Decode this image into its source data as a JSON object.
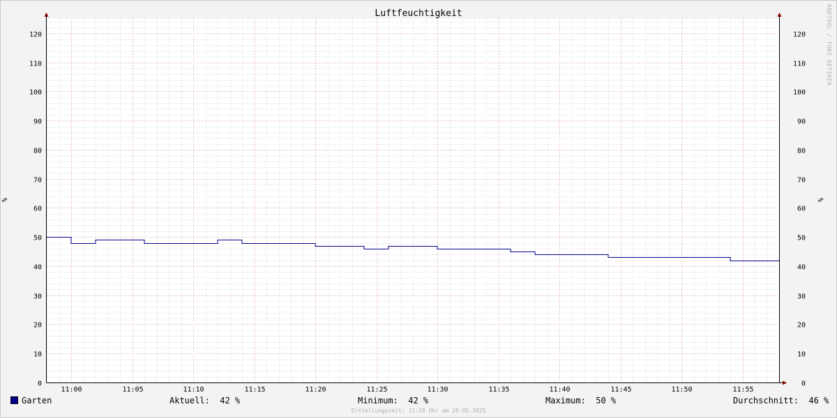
{
  "chart_data": {
    "type": "line",
    "title": "Luftfeuchtigkeit",
    "ylabel": "%",
    "ylim": [
      0,
      125
    ],
    "yticks": [
      0,
      10,
      20,
      30,
      40,
      50,
      60,
      70,
      80,
      90,
      100,
      110,
      120
    ],
    "xlim": [
      "10:58",
      "11:58"
    ],
    "xticks": [
      "11:00",
      "11:05",
      "11:10",
      "11:15",
      "11:20",
      "11:25",
      "11:30",
      "11:35",
      "11:40",
      "11:45",
      "11:50",
      "11:55"
    ],
    "grid": true,
    "series": [
      {
        "name": "Garten",
        "color": "#00008b",
        "x": [
          "10:58",
          "11:00",
          "11:02",
          "11:06",
          "11:12",
          "11:14",
          "11:20",
          "11:24",
          "11:26",
          "11:30",
          "11:36",
          "11:38",
          "11:44",
          "11:54",
          "11:58"
        ],
        "y": [
          50,
          48,
          49,
          48,
          49,
          48,
          47,
          46,
          47,
          46,
          45,
          44,
          43,
          42,
          42
        ]
      }
    ]
  },
  "legend": {
    "series_name": "Garten",
    "current_label": "Aktuell:",
    "current_value": "42 %",
    "min_label": "Minimum:",
    "min_value": "42 %",
    "max_label": "Maximum:",
    "max_value": "50 %",
    "avg_label": "Durchschnitt:",
    "avg_value": "46 %"
  },
  "watermark": "RRDTOOL / TOBI OETIKER",
  "created": "Erstellungszeit: 11:58 Uhr am 20.05.2025",
  "colors": {
    "background": "#f3f3f3",
    "plot": "#ffffff",
    "major_grid": "#e6a0a0",
    "minor_grid": "#d8d8d8",
    "line": "#00008b",
    "axis_arrow": "#8b0000"
  }
}
